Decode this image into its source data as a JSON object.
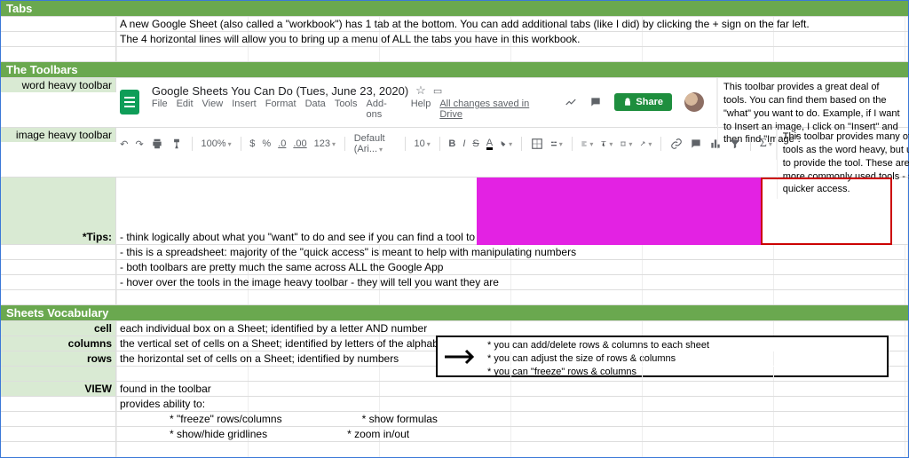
{
  "sections": {
    "tabs": {
      "header": "Tabs",
      "lines": [
        "A new Google Sheet (also called a \"workbook\") has 1 tab at the bottom. You can add additional tabs (like I did) by clicking the + sign on the far left.",
        "The 4 horizontal lines will allow you to bring up a menu of ALL the tabs you have in this workbook."
      ]
    },
    "toolbars": {
      "header": "The Toolbars",
      "word_heavy_label": "word heavy toolbar",
      "image_heavy_label": "image heavy toolbar",
      "word_heavy_desc": "This toolbar provides a great deal of tools. You can find them based on the \"what\" you want to do. Example, if I want to Insert an image, I click on \"Insert\" and then find \"Image\".",
      "image_heavy_desc": "This toolbar provides many of the same tools as the word heavy, but uses images to provide the tool. These are also the more commonly used tools - so it's quicker access.",
      "doc_title": "Google Sheets You Can Do (Tues, June 23, 2020)",
      "menu": [
        "File",
        "Edit",
        "View",
        "Insert",
        "Format",
        "Data",
        "Tools",
        "Add-ons",
        "Help"
      ],
      "saved_text": "All changes saved in Drive",
      "share_label": "Share",
      "zoom": "100%",
      "currency": "$",
      "pct": "%",
      "dec1": ".0",
      "dec2": ".00",
      "fmt": "123",
      "font_name": "Default (Ari...",
      "font_size": "10",
      "bold": "B",
      "italic": "I",
      "strike": "S",
      "underline_a": "A"
    },
    "tips": {
      "label": "*Tips:",
      "lines": [
        "- think logically about what you \"want\" to do and see if you can find a tool to help",
        "- this is a spreadsheet: majority of the \"quick access\" is meant to help with manipulating numbers",
        "- both toolbars are pretty much the same across ALL the Google App",
        "- hover over the tools in the image heavy toolbar - they will tell you want they are"
      ]
    },
    "vocab": {
      "header": "Sheets Vocabulary",
      "cell": {
        "label": "cell",
        "def": "each individual box on a Sheet; identified by a letter AND number"
      },
      "columns": {
        "label": "columns",
        "def": "the vertical set of cells on a Sheet; identified by letters of the alphabet"
      },
      "rows": {
        "label": "rows",
        "def": "the horizontal set of cells on a Sheet; identified by numbers"
      },
      "callout": [
        "* you can add/delete rows & columns to each sheet",
        "* you can adjust the size of rows & columns",
        "* you can \"freeze\" rows & columns"
      ],
      "view": {
        "label": "VIEW",
        "def": "found in the toolbar",
        "subtitle": "provides ability to:",
        "items_col1": [
          "* \"freeze\" rows/columns",
          "* show/hide gridlines"
        ],
        "items_col2": [
          "* show formulas",
          "* zoom in/out"
        ]
      }
    }
  }
}
